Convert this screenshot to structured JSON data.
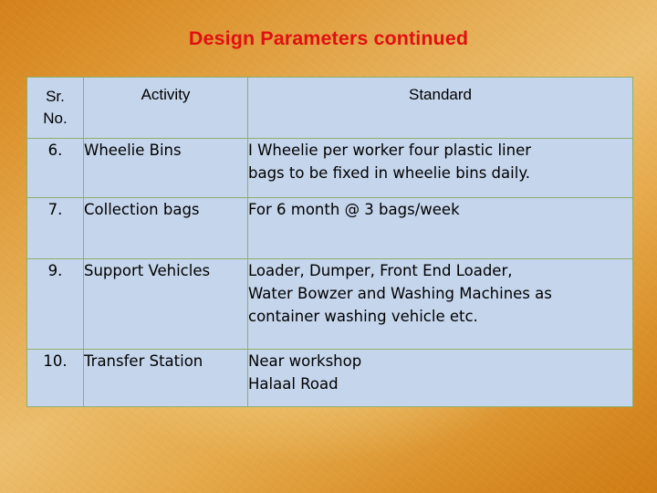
{
  "slide": {
    "title": "Design Parameters continued",
    "title_color": "#e01010",
    "background_colors": {
      "edge": "#d4811a",
      "center": "#ecc071"
    },
    "table_cell_color": "#c5d5ec",
    "table_border_color": "#8fae6e"
  },
  "table": {
    "headers": {
      "sr_no_line1": "Sr.",
      "sr_no_line2": "No.",
      "activity": "Activity",
      "standard": "Standard"
    },
    "rows": [
      {
        "sr_no": "6.",
        "activity": "Wheelie Bins",
        "standard_lines": [
          "I Wheelie per worker four plastic liner",
          "bags to be fixed in wheelie bins daily."
        ]
      },
      {
        "sr_no": "7.",
        "activity": "Collection bags",
        "standard_lines": [
          "For 6 month @ 3 bags/week"
        ]
      },
      {
        "sr_no": "9.",
        "activity": "Support Vehicles",
        "standard_lines": [
          "Loader, Dumper, Front End Loader,",
          "Water Bowzer and Washing Machines as",
          "container washing vehicle etc."
        ]
      },
      {
        "sr_no": "10.",
        "activity": "Transfer Station",
        "standard_lines": [
          "Near workshop",
          "Halaal Road"
        ]
      }
    ]
  }
}
